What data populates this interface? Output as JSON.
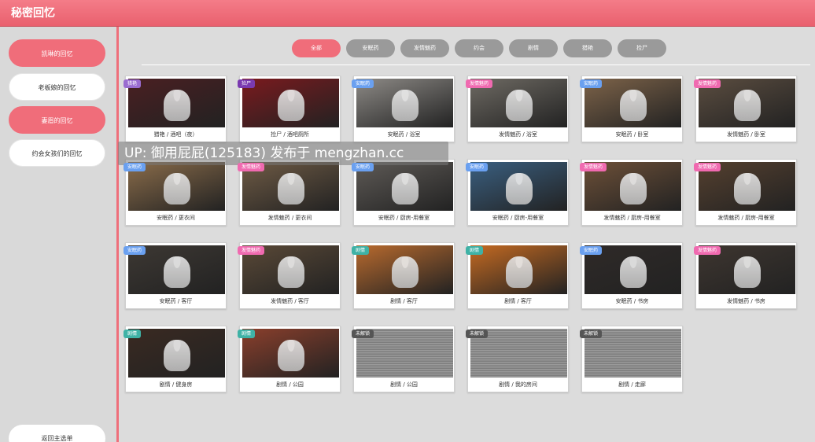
{
  "window": {
    "title": "秘密回忆"
  },
  "sidebar": {
    "items": [
      {
        "label": "凯琳的回忆",
        "active": true
      },
      {
        "label": "老板娘的回忆",
        "active": false
      },
      {
        "label": "妻眉的回忆",
        "active": true
      },
      {
        "label": "约会女孩们的回忆",
        "active": false
      }
    ],
    "back_label": "返回主选单"
  },
  "filters": [
    {
      "label": "全部",
      "active": true
    },
    {
      "label": "安眠药",
      "active": false
    },
    {
      "label": "发情魅药",
      "active": false
    },
    {
      "label": "约会",
      "active": false
    },
    {
      "label": "剧情",
      "active": false
    },
    {
      "label": "猎艳",
      "active": false
    },
    {
      "label": "捡尸",
      "active": false
    }
  ],
  "colors": {
    "accent": "#f06d7a",
    "badge_sleep": "#6aa0f0",
    "badge_lust": "#f06ab0",
    "badge_story": "#3fb2a6",
    "badge_hunt": "#9a6cd0",
    "badge_corpse": "#7a3ab0",
    "badge_locked": "#555555"
  },
  "cards": [
    {
      "badge": "猎艳",
      "badge_type": "hunt",
      "caption": "猎艳 / 酒吧（夜）",
      "bg": "#4a1f22"
    },
    {
      "badge": "捡尸",
      "badge_type": "corpse",
      "caption": "捡尸 / 酒吧厕所",
      "bg": "#7a1a1e"
    },
    {
      "badge": "安眠药",
      "badge_type": "sleep",
      "caption": "安眠药 / 浴室",
      "bg": "#8d8a86"
    },
    {
      "badge": "发情魅药",
      "badge_type": "lust",
      "caption": "发情魅药 / 浴室",
      "bg": "#6e6a63"
    },
    {
      "badge": "安眠药",
      "badge_type": "sleep",
      "caption": "安眠药 / 卧室",
      "bg": "#7d6349"
    },
    {
      "badge": "发情魅药",
      "badge_type": "lust",
      "caption": "发情魅药 / 卧室",
      "bg": "#5b4d40"
    },
    {
      "badge": "安眠药",
      "badge_type": "sleep",
      "caption": "安眠药 / 更衣间",
      "bg": "#8a6c4a"
    },
    {
      "badge": "发情魅药",
      "badge_type": "lust",
      "caption": "发情魅药 / 更衣间",
      "bg": "#6f5b45"
    },
    {
      "badge": "安眠药",
      "badge_type": "sleep",
      "caption": "安眠药 / 厨房-用餐室",
      "bg": "#5e5a56"
    },
    {
      "badge": "安眠药",
      "badge_type": "sleep",
      "caption": "安眠药 / 厨房-用餐室",
      "bg": "#3a5f80"
    },
    {
      "badge": "发情魅药",
      "badge_type": "lust",
      "caption": "发情魅药 / 厨房-用餐室",
      "bg": "#6d5038"
    },
    {
      "badge": "发情魅药",
      "badge_type": "lust",
      "caption": "发情魅药 / 厨房-用餐室",
      "bg": "#55402f"
    },
    {
      "badge": "安眠药",
      "badge_type": "sleep",
      "caption": "安眠药 / 客厅",
      "bg": "#3d3833"
    },
    {
      "badge": "发情魅药",
      "badge_type": "lust",
      "caption": "发情魅药 / 客厅",
      "bg": "#5a4937"
    },
    {
      "badge": "剧情",
      "badge_type": "story",
      "caption": "剧情 / 客厅",
      "bg": "#b86a2e"
    },
    {
      "badge": "剧情",
      "badge_type": "story",
      "caption": "剧情 / 客厅",
      "bg": "#c46a22"
    },
    {
      "badge": "安眠药",
      "badge_type": "sleep",
      "caption": "安眠药 / 书房",
      "bg": "#2f2a28"
    },
    {
      "badge": "发情魅药",
      "badge_type": "lust",
      "caption": "发情魅药 / 书房",
      "bg": "#3e3630"
    },
    {
      "badge": "剧情",
      "badge_type": "story",
      "caption": "剧情 / 健身房",
      "bg": "#3a2a22"
    },
    {
      "badge": "剧情",
      "badge_type": "story",
      "caption": "剧情 / 公园",
      "bg": "#8a3f2c"
    },
    {
      "badge": "未解锁",
      "badge_type": "locked",
      "caption": "剧情 / 公园",
      "bg": "locked"
    },
    {
      "badge": "未解锁",
      "badge_type": "locked",
      "caption": "剧情 / 我的房间",
      "bg": "locked"
    },
    {
      "badge": "未解锁",
      "badge_type": "locked",
      "caption": "剧情 / 走廊",
      "bg": "locked"
    }
  ],
  "overlay": {
    "watermark": "UP: 御用屁屁(125183) 发布于 mengzhan.cc"
  }
}
